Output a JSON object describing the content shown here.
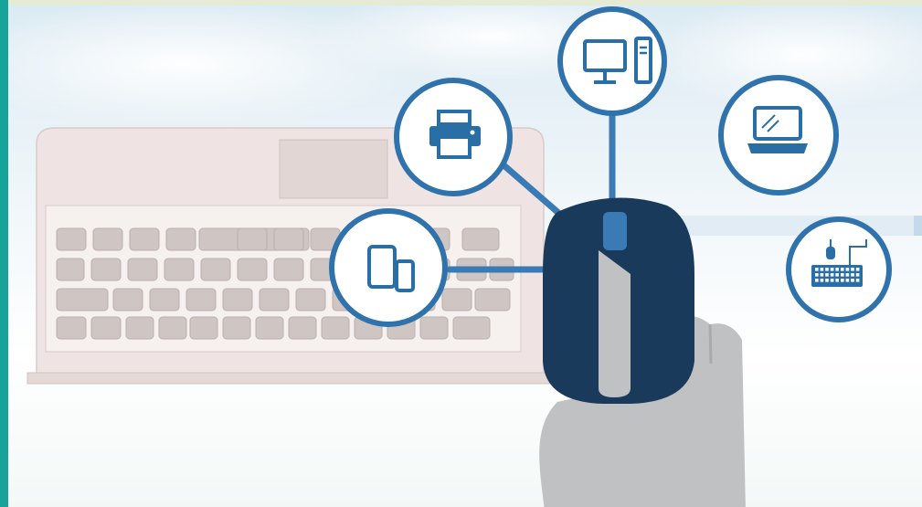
{
  "scene": {
    "colors": {
      "accent_teal": "#16a39a",
      "mouse_navy": "#1a3a5c",
      "icon_blue": "#2a6ea6",
      "ring_blue": "#2f72ac",
      "connector_blue": "#3a7bb5",
      "hand_gray": "#bdbfc1",
      "laptop_body": "#efe5e3",
      "key_gray": "#cfc6c4"
    },
    "devices": [
      {
        "id": "desktop",
        "icon": "desktop-computer-icon"
      },
      {
        "id": "printer",
        "icon": "printer-icon"
      },
      {
        "id": "laptop",
        "icon": "laptop-icon"
      },
      {
        "id": "tablet-phone",
        "icon": "tablet-phone-icon"
      },
      {
        "id": "keyboard-mouse",
        "icon": "keyboard-mouse-icon"
      }
    ]
  }
}
